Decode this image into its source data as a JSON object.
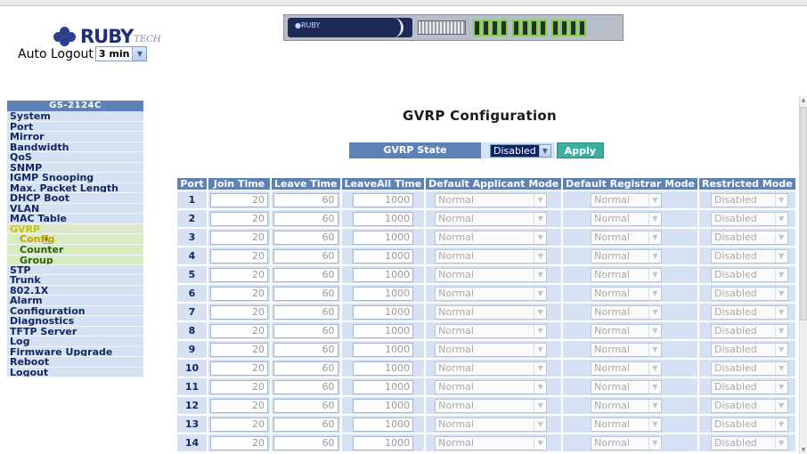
{
  "header": {
    "logo_text": "RUBY",
    "logo_suffix": "TECH",
    "auto_logout_label": "Auto Logout",
    "auto_logout_value": "3 min",
    "device_logo": "●RUBY"
  },
  "sidebar": {
    "title": "GS-2124C",
    "items": [
      {
        "label": "System"
      },
      {
        "label": "Port"
      },
      {
        "label": "Mirror"
      },
      {
        "label": "Bandwidth"
      },
      {
        "label": "QoS"
      },
      {
        "label": "SNMP"
      },
      {
        "label": "IGMP Snooping"
      },
      {
        "label": "Max. Packet Length"
      },
      {
        "label": "DHCP Boot"
      },
      {
        "label": "VLAN"
      },
      {
        "label": "MAC Table"
      },
      {
        "label": "GVRP"
      }
    ],
    "gvrp_sub": [
      {
        "label": "Config"
      },
      {
        "label": "Counter"
      },
      {
        "label": "Group"
      }
    ],
    "items_after": [
      {
        "label": "STP"
      },
      {
        "label": "Trunk"
      },
      {
        "label": "802.1X"
      },
      {
        "label": "Alarm"
      },
      {
        "label": "Configuration"
      },
      {
        "label": "Diagnostics"
      },
      {
        "label": "TFTP Server"
      },
      {
        "label": "Log"
      },
      {
        "label": "Firmware Upgrade"
      },
      {
        "label": "Reboot"
      },
      {
        "label": "Logout"
      }
    ]
  },
  "main": {
    "title": "GVRP Configuration",
    "state_label": "GVRP State",
    "state_value": "Disabled",
    "apply_label": "Apply",
    "columns": [
      "Port",
      "Join Time",
      "Leave Time",
      "LeaveAll Time",
      "Default Applicant Mode",
      "Default Registrar Mode",
      "Restricted Mode"
    ],
    "rows": [
      {
        "port": "1",
        "join": "20",
        "leave": "60",
        "leaveall": "1000",
        "applicant": "Normal",
        "registrar": "Normal",
        "restricted": "Disabled"
      },
      {
        "port": "2",
        "join": "20",
        "leave": "60",
        "leaveall": "1000",
        "applicant": "Normal",
        "registrar": "Normal",
        "restricted": "Disabled"
      },
      {
        "port": "3",
        "join": "20",
        "leave": "60",
        "leaveall": "1000",
        "applicant": "Normal",
        "registrar": "Normal",
        "restricted": "Disabled"
      },
      {
        "port": "4",
        "join": "20",
        "leave": "60",
        "leaveall": "1000",
        "applicant": "Normal",
        "registrar": "Normal",
        "restricted": "Disabled"
      },
      {
        "port": "5",
        "join": "20",
        "leave": "60",
        "leaveall": "1000",
        "applicant": "Normal",
        "registrar": "Normal",
        "restricted": "Disabled"
      },
      {
        "port": "6",
        "join": "20",
        "leave": "60",
        "leaveall": "1000",
        "applicant": "Normal",
        "registrar": "Normal",
        "restricted": "Disabled"
      },
      {
        "port": "7",
        "join": "20",
        "leave": "60",
        "leaveall": "1000",
        "applicant": "Normal",
        "registrar": "Normal",
        "restricted": "Disabled"
      },
      {
        "port": "8",
        "join": "20",
        "leave": "60",
        "leaveall": "1000",
        "applicant": "Normal",
        "registrar": "Normal",
        "restricted": "Disabled"
      },
      {
        "port": "9",
        "join": "20",
        "leave": "60",
        "leaveall": "1000",
        "applicant": "Normal",
        "registrar": "Normal",
        "restricted": "Disabled"
      },
      {
        "port": "10",
        "join": "20",
        "leave": "60",
        "leaveall": "1000",
        "applicant": "Normal",
        "registrar": "Normal",
        "restricted": "Disabled"
      },
      {
        "port": "11",
        "join": "20",
        "leave": "60",
        "leaveall": "1000",
        "applicant": "Normal",
        "registrar": "Normal",
        "restricted": "Disabled"
      },
      {
        "port": "12",
        "join": "20",
        "leave": "60",
        "leaveall": "1000",
        "applicant": "Normal",
        "registrar": "Normal",
        "restricted": "Disabled"
      },
      {
        "port": "13",
        "join": "20",
        "leave": "60",
        "leaveall": "1000",
        "applicant": "Normal",
        "registrar": "Normal",
        "restricted": "Disabled"
      },
      {
        "port": "14",
        "join": "20",
        "leave": "60",
        "leaveall": "1000",
        "applicant": "Normal",
        "registrar": "Normal",
        "restricted": "Disabled"
      }
    ]
  },
  "icons": {
    "dropdown": "chevron-down-icon",
    "cursor": "hand-pointer-icon",
    "logo": "ruby-logo-icon"
  },
  "colors": {
    "header_blue": "#5f82b6",
    "cell_blue": "#d6e2f3",
    "apply_teal": "#3ab0a0",
    "gvrp_active": "#c6c600"
  }
}
